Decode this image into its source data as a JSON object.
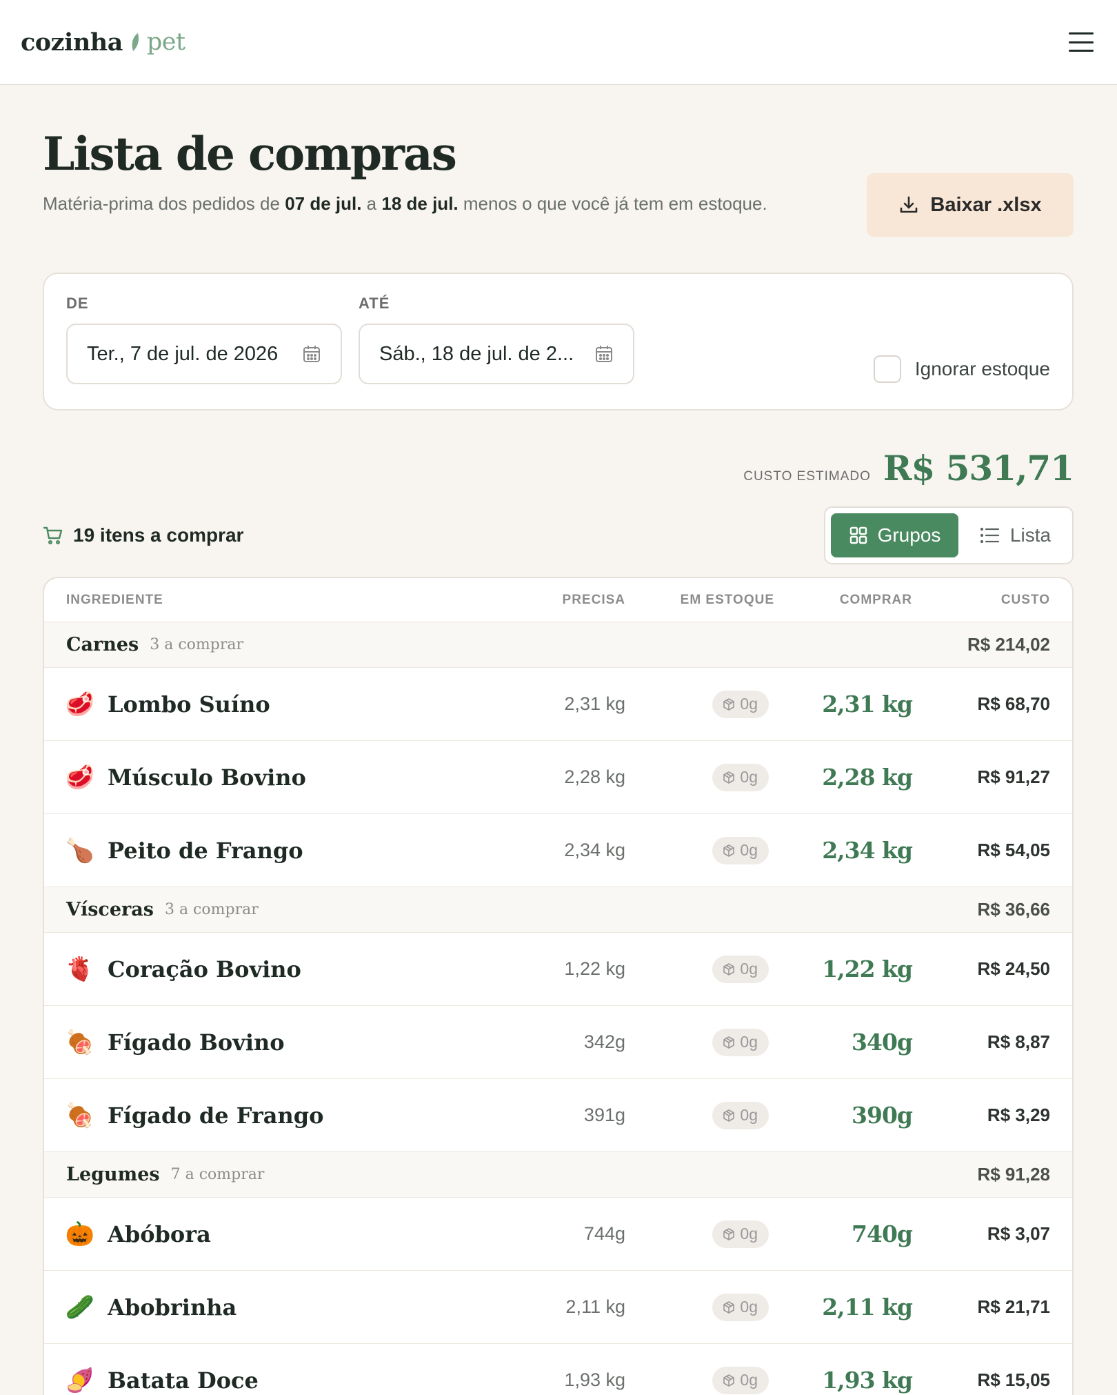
{
  "app": {
    "logo_word1": "cozinha",
    "logo_word2": "pet"
  },
  "header": {
    "title": "Lista de compras",
    "subtitle_pre": "Matéria-prima dos pedidos de ",
    "subtitle_from": "07 de jul.",
    "subtitle_mid": " a ",
    "subtitle_to": "18 de jul.",
    "subtitle_post": " menos o que você já tem em estoque.",
    "download_label": "Baixar .xlsx"
  },
  "filters": {
    "from_label": "DE",
    "from_value": "Ter., 7 de jul. de 2026",
    "to_label": "ATÉ",
    "to_value": "Sáb., 18 de jul. de 2...",
    "ignore_stock_label": "Ignorar estoque",
    "ignore_stock_checked": false
  },
  "summary": {
    "cost_label": "CUSTO ESTIMADO",
    "cost_value": "R$ 531,71",
    "items_count": "19 itens a comprar"
  },
  "view_toggle": {
    "groups_label": "Grupos",
    "list_label": "Lista",
    "active": "Grupos"
  },
  "table": {
    "columns": {
      "ingredient": "INGREDIENTE",
      "need": "PRECISA",
      "stock": "EM ESTOQUE",
      "buy": "COMPRAR",
      "cost": "CUSTO"
    },
    "groups": [
      {
        "name": "Carnes",
        "count": "3 a comprar",
        "total": "R$ 214,02",
        "items": [
          {
            "emoji": "🥩",
            "name": "Lombo Suíno",
            "need": "2,31 kg",
            "stock": "0g",
            "buy": "2,31 kg",
            "cost": "R$ 68,70"
          },
          {
            "emoji": "🥩",
            "name": "Músculo Bovino",
            "need": "2,28 kg",
            "stock": "0g",
            "buy": "2,28 kg",
            "cost": "R$ 91,27"
          },
          {
            "emoji": "🍗",
            "name": "Peito de Frango",
            "need": "2,34 kg",
            "stock": "0g",
            "buy": "2,34 kg",
            "cost": "R$ 54,05"
          }
        ]
      },
      {
        "name": "Vísceras",
        "count": "3 a comprar",
        "total": "R$ 36,66",
        "items": [
          {
            "emoji": "🫀",
            "name": "Coração Bovino",
            "need": "1,22 kg",
            "stock": "0g",
            "buy": "1,22 kg",
            "cost": "R$ 24,50"
          },
          {
            "emoji": "🍖",
            "name": "Fígado Bovino",
            "need": "342g",
            "stock": "0g",
            "buy": "340g",
            "cost": "R$ 8,87"
          },
          {
            "emoji": "🍖",
            "name": "Fígado de Frango",
            "need": "391g",
            "stock": "0g",
            "buy": "390g",
            "cost": "R$ 3,29"
          }
        ]
      },
      {
        "name": "Legumes",
        "count": "7 a comprar",
        "total": "R$ 91,28",
        "items": [
          {
            "emoji": "🎃",
            "name": "Abóbora",
            "need": "744g",
            "stock": "0g",
            "buy": "740g",
            "cost": "R$ 3,07"
          },
          {
            "emoji": "🥒",
            "name": "Abobrinha",
            "need": "2,11 kg",
            "stock": "0g",
            "buy": "2,11 kg",
            "cost": "R$ 21,71"
          },
          {
            "emoji": "🍠",
            "name": "Batata Doce",
            "need": "1,93 kg",
            "stock": "0g",
            "buy": "1,93 kg",
            "cost": "R$ 15,05"
          }
        ]
      }
    ]
  },
  "colors": {
    "accent_green": "#3f7a54",
    "toggle_active_bg": "#4a8a60",
    "download_bg": "#f8e7d6",
    "page_bg": "#f8f5f1",
    "logo_green": "#7aa889"
  },
  "icons": {
    "menu": "hamburger-menu-icon",
    "download": "download-icon",
    "calendar": "calendar-icon",
    "cart": "shopping-cart-icon",
    "grid": "grid-icon",
    "list": "list-icon",
    "stock": "box-icon"
  }
}
